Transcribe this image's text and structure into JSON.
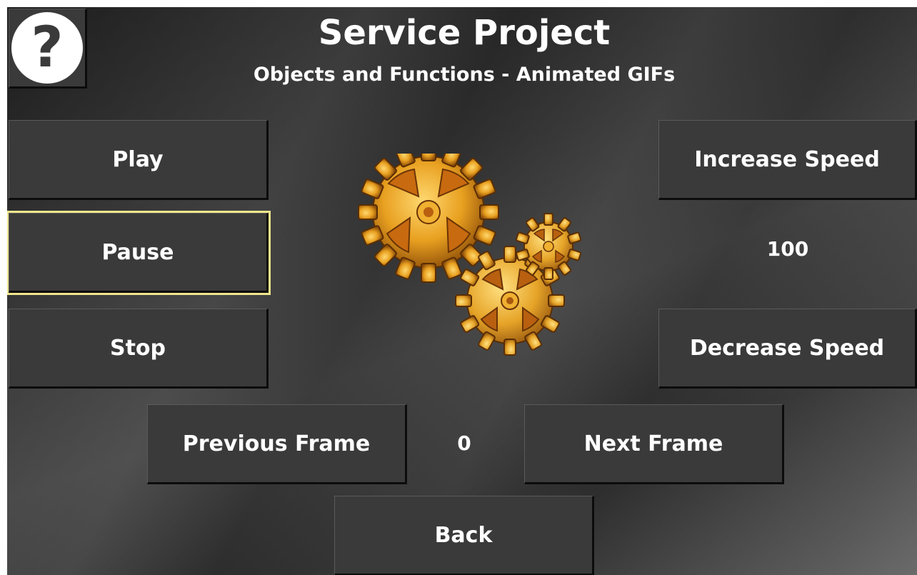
{
  "header": {
    "title": "Service Project",
    "subtitle": "Objects and Functions - Animated GIFs",
    "help_glyph": "?"
  },
  "controls": {
    "play_label": "Play",
    "pause_label": "Pause",
    "stop_label": "Stop",
    "increase_speed_label": "Increase Speed",
    "decrease_speed_label": "Decrease Speed",
    "speed_value": "100",
    "previous_frame_label": "Previous Frame",
    "next_frame_label": "Next Frame",
    "frame_value": "0",
    "back_label": "Back"
  },
  "animation": {
    "icon": "gears-animated-gif"
  },
  "colors": {
    "background": "#2e2e2e",
    "button": "#3a3a3a",
    "focus_outline": "#f0e68c",
    "gear_gold": "#e8a020",
    "text": "#ffffff"
  }
}
